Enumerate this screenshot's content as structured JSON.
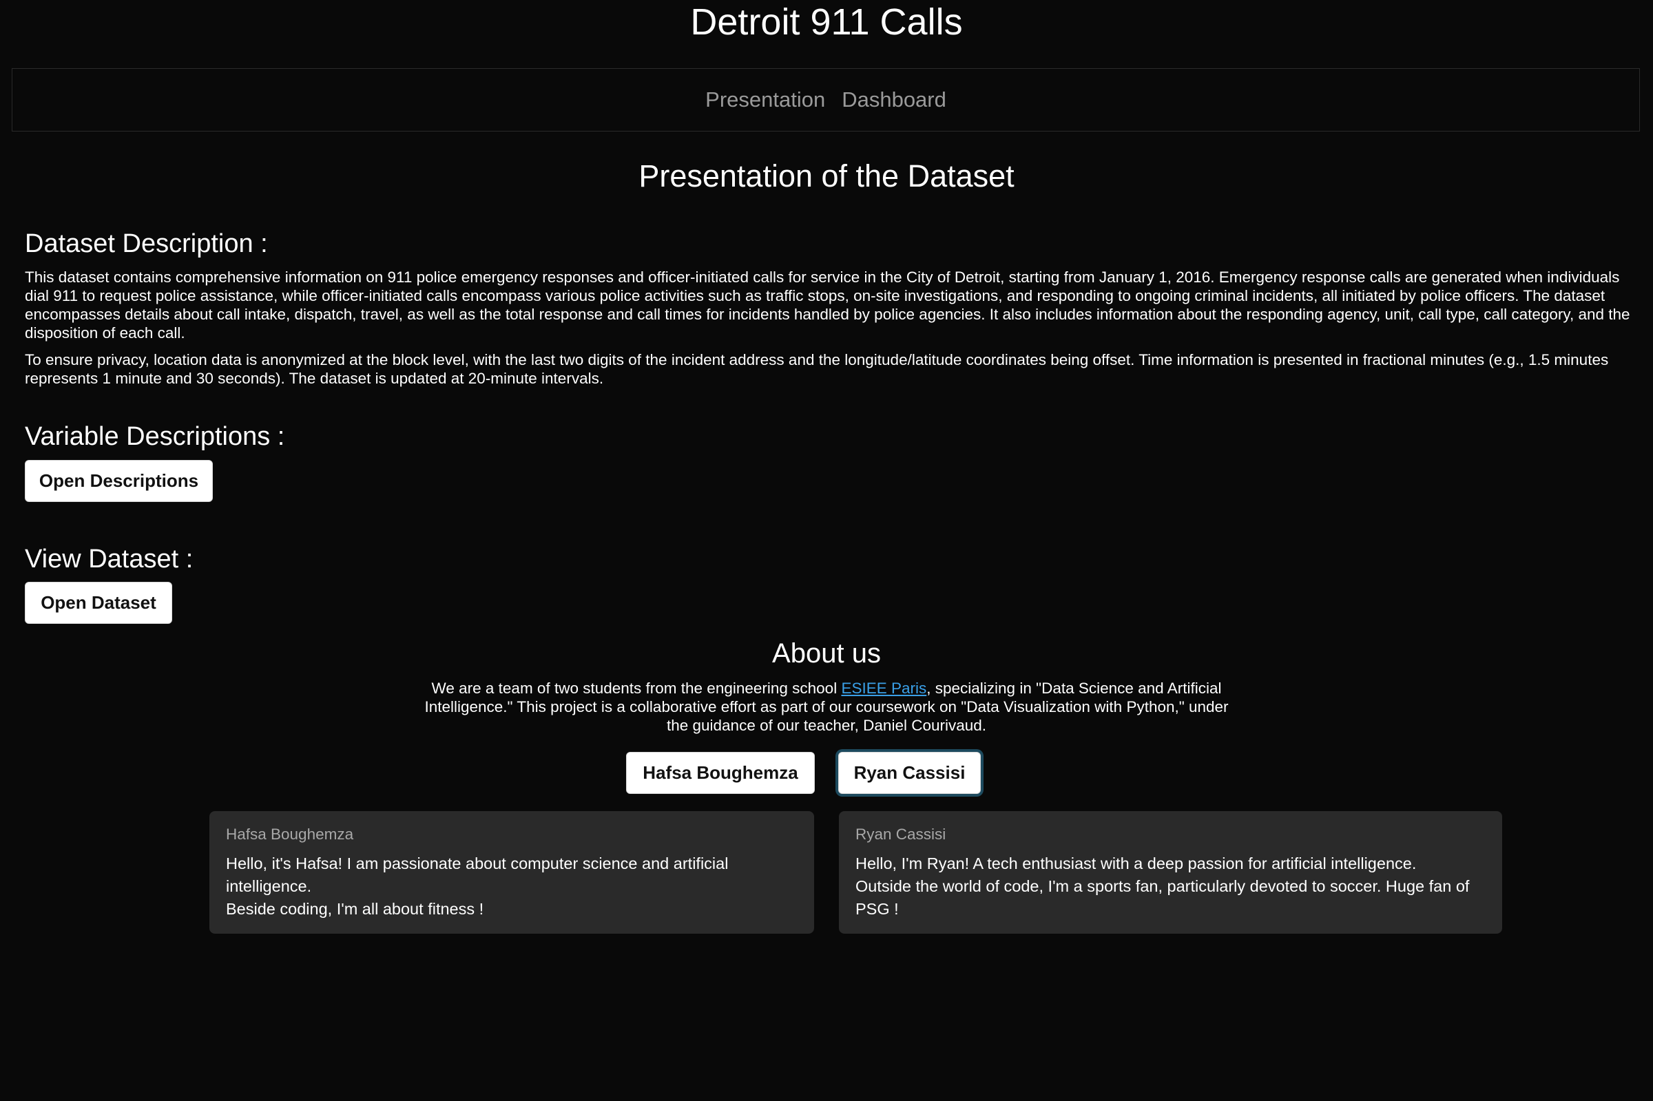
{
  "app": {
    "title": "Detroit 911 Calls"
  },
  "nav": {
    "links": [
      "Presentation",
      "Dashboard"
    ]
  },
  "presentation": {
    "title": "Presentation of the Dataset",
    "dataset_description": {
      "heading": "Dataset Description :",
      "paragraphs": [
        "This dataset contains comprehensive information on 911 police emergency responses and officer-initiated calls for service in the City of Detroit, starting from January 1, 2016. Emergency response calls are generated when individuals dial 911 to request police assistance, while officer-initiated calls encompass various police activities such as traffic stops, on-site investigations, and responding to ongoing criminal incidents, all initiated by police officers. The dataset encompasses details about call intake, dispatch, travel, as well as the total response and call times for incidents handled by police agencies. It also includes information about the responding agency, unit, call type, call category, and the disposition of each call.",
        "To ensure privacy, location data is anonymized at the block level, with the last two digits of the incident address and the longitude/latitude coordinates being offset. Time information is presented in fractional minutes (e.g., 1.5 minutes represents 1 minute and 30 seconds). The dataset is updated at 20-minute intervals."
      ]
    },
    "variable_descriptions": {
      "heading": "Variable Descriptions :",
      "button_label": "Open Descriptions"
    },
    "view_dataset": {
      "heading": "View Dataset :",
      "button_label": "Open Dataset"
    }
  },
  "about": {
    "title": "About us",
    "text_before_link": "We are a team of two students from the engineering school ",
    "link_text": "ESIEE Paris",
    "text_after_link": ", specializing in \"Data Science and Artificial Intelligence.\" This project is a collaborative effort as part of our coursework on \"Data Visualization with Python,\" under the guidance of our teacher, Daniel Courivaud.",
    "buttons": [
      "Hafsa Boughemza",
      "Ryan Cassisi"
    ],
    "cards": [
      {
        "name": "Hafsa Boughemza",
        "lines": [
          "Hello, it's Hafsa! I am passionate about computer science and artificial intelligence.",
          "Beside coding, I'm all about fitness !"
        ]
      },
      {
        "name": "Ryan Cassisi",
        "lines": [
          "Hello, I'm Ryan! A tech enthusiast with a deep passion for artificial intelligence.",
          "Outside the world of code, I'm a sports fan, particularly devoted to soccer. Huge fan of PSG !"
        ]
      }
    ]
  },
  "colors": {
    "background": "#090909",
    "card_background": "#2a2a2a",
    "link": "#3aa0e8",
    "nav_link": "#9a9a9a",
    "focus_ring": "#1d4a5e"
  }
}
